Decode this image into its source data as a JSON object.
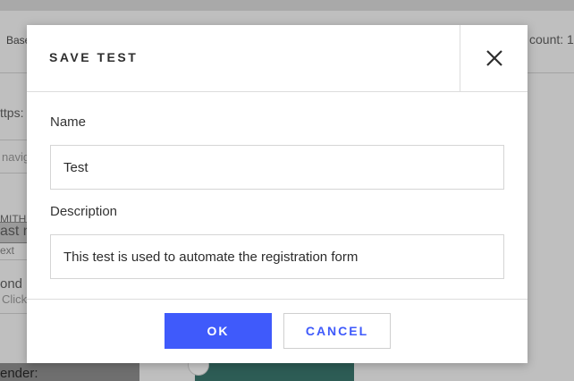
{
  "background": {
    "toolbar_left": "Base",
    "url_fragment": "ttps:",
    "nav_placeholder": "navig",
    "count_label": "count: 1",
    "fragment_mith": "MITH",
    "fragment_last": "ast n",
    "fragment_ext": "ext",
    "fragment_ond": "ond",
    "fragment_click": "Click",
    "fragment_ender": "ender:"
  },
  "dialog": {
    "title": "SAVE TEST",
    "close_icon": "close-icon",
    "fields": {
      "name": {
        "label": "Name",
        "value": "Test"
      },
      "description": {
        "label": "Description",
        "value": "This test is used to automate the registration form"
      }
    },
    "ok_label": "OK",
    "cancel_label": "CANCEL"
  },
  "colors": {
    "accent": "#3f5afb",
    "overlay": "#bfbfbf"
  }
}
